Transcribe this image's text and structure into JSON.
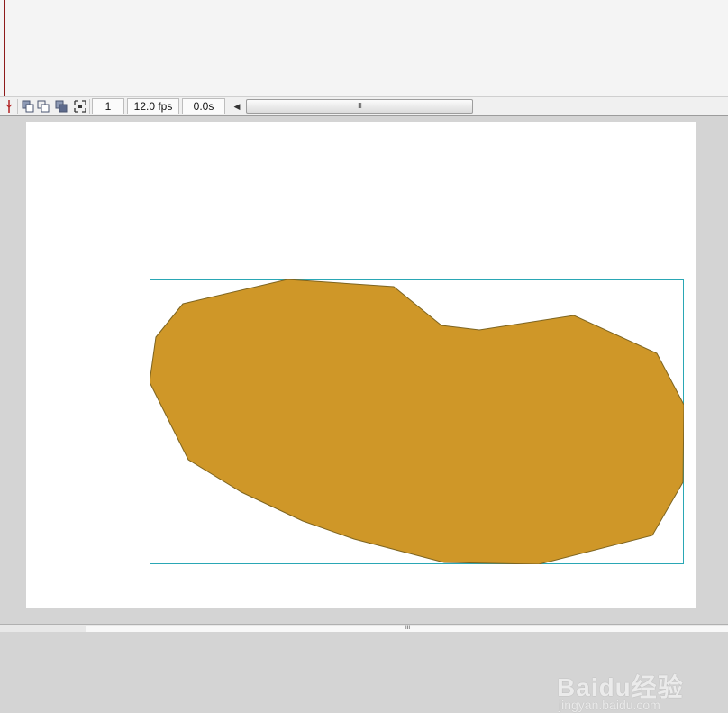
{
  "timeline": {
    "frame_number": "1",
    "frame_rate": "12.0 fps",
    "elapsed_time": "0.0s",
    "scroll_grip": "III",
    "tools": [
      "center-frame-icon",
      "onion-skin-icon",
      "onion-skin-outlines-icon",
      "edit-multiple-frames-icon",
      "modify-onion-markers-icon"
    ]
  },
  "stage": {
    "background": "#ffffff",
    "pasteboard": "#d4d4d4",
    "shape_fill": "#cf9728",
    "shape_stroke": "#7d6420",
    "selection_box_color": "#2aa7b5"
  },
  "watermark": {
    "brand": "Baidu经验",
    "url": "jingyan.baidu.com"
  },
  "bottom_scrollbar": {
    "grip": "III"
  }
}
